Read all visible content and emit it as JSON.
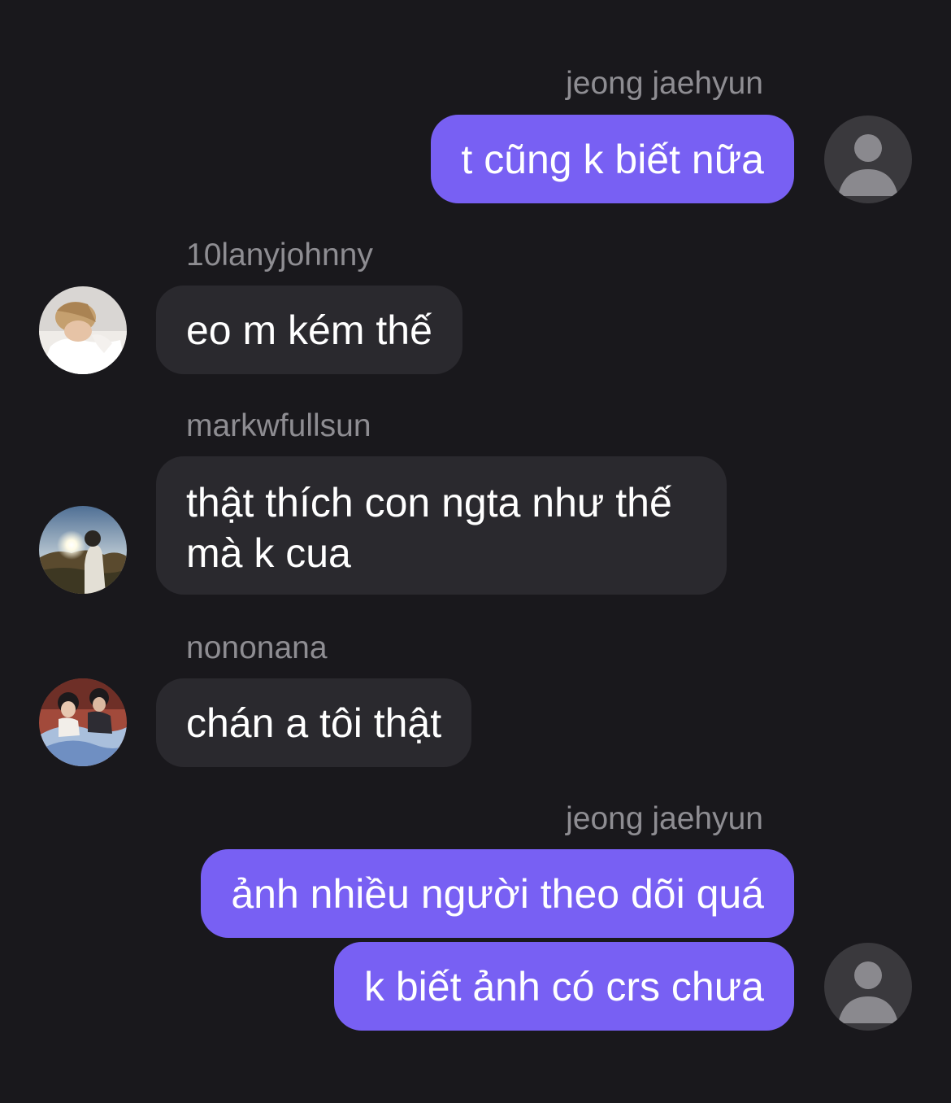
{
  "messages": [
    {
      "sender": "jeong jaehyun",
      "text": "t cũng k biết nữa",
      "outgoing": true
    },
    {
      "sender": "10lanyjohnny",
      "text": "eo m kém thế",
      "outgoing": false
    },
    {
      "sender": "markwfullsun",
      "text": "thật thích con ngta như thế mà k cua",
      "outgoing": false
    },
    {
      "sender": "nononana",
      "text": "chán a tôi thật",
      "outgoing": false
    },
    {
      "sender": "jeong jaehyun",
      "text": "ảnh nhiều người theo dõi quá",
      "outgoing": true
    },
    {
      "sender": "",
      "text": "k biết ảnh có crs chưa",
      "outgoing": true
    }
  ],
  "colors": {
    "background": "#19181c",
    "outgoing_bubble": "#7860f3",
    "incoming_bubble": "#2a292e",
    "sender_name": "#8e8d92"
  },
  "icons": {
    "default_avatar": "person-silhouette-icon"
  }
}
